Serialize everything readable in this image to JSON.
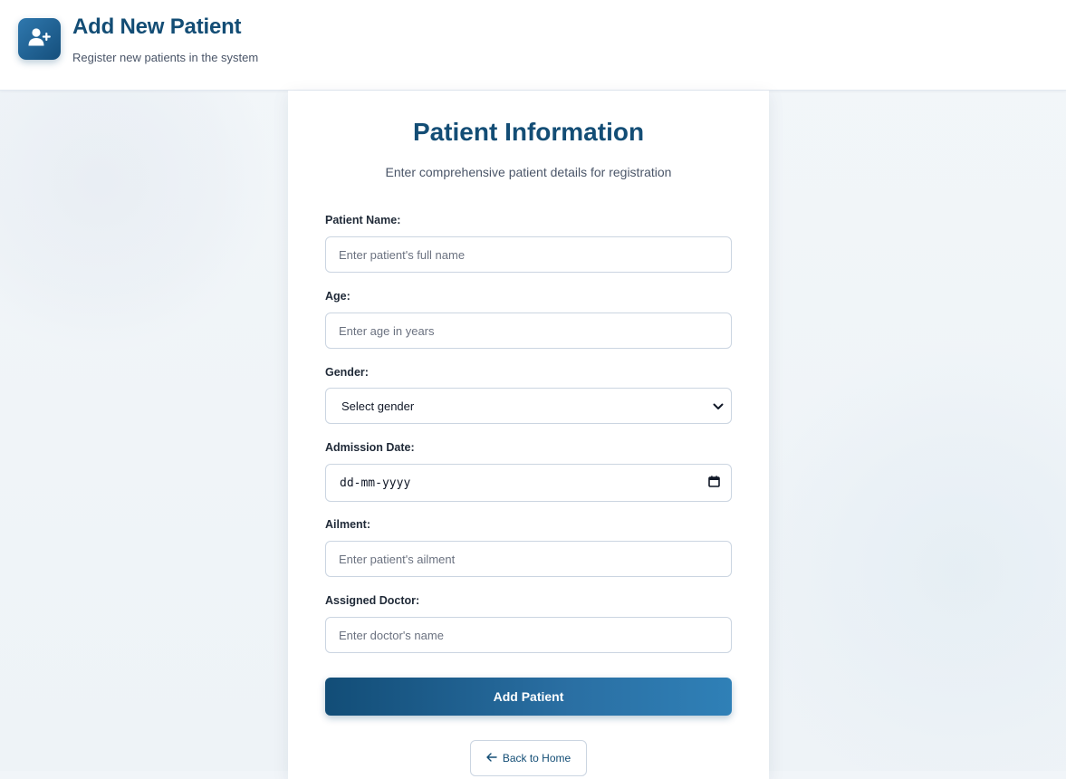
{
  "header": {
    "title": "Add New Patient",
    "subtitle": "Register new patients in the system",
    "icon": "user-plus-icon"
  },
  "form": {
    "title": "Patient Information",
    "subtitle": "Enter comprehensive patient details for registration",
    "fields": {
      "name": {
        "label": "Patient Name:",
        "placeholder": "Enter patient's full name",
        "value": ""
      },
      "age": {
        "label": "Age:",
        "placeholder": "Enter age in years",
        "value": ""
      },
      "gender": {
        "label": "Gender:",
        "selected": "Select gender",
        "icon": "chevron-down-icon"
      },
      "admission_date": {
        "label": "Admission Date:",
        "value": "dd-mm-yyyy",
        "icon": "calendar-icon"
      },
      "ailment": {
        "label": "Ailment:",
        "placeholder": "Enter patient's ailment",
        "value": ""
      },
      "doctor": {
        "label": "Assigned Doctor:",
        "placeholder": "Enter doctor's name",
        "value": ""
      }
    },
    "submit_label": "Add Patient",
    "back_label": "Back to Home",
    "back_icon": "arrow-left-icon"
  },
  "colors": {
    "primary": "#134d75",
    "accent": "#2f80b7",
    "background": "#f1f5f9"
  }
}
